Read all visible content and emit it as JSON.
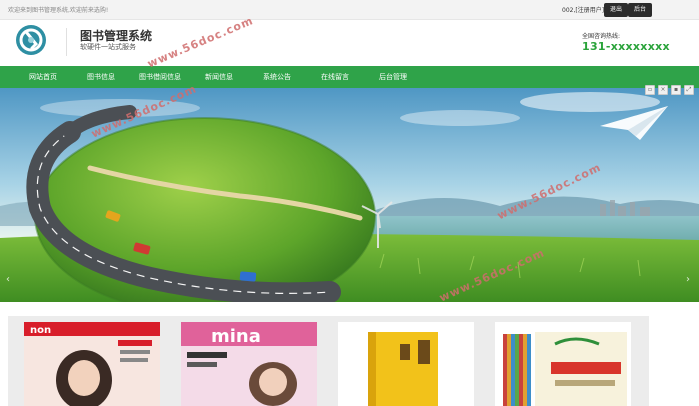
{
  "topbar": {
    "welcome": "欢迎来到图书管理系统,欢迎前来选购!",
    "user": "002,[注册用户]",
    "logout_label": "退出",
    "admin_label": "后台"
  },
  "header": {
    "title": "图书管理系统",
    "subtitle": "软硬件一站式服务",
    "hotline_label": "全国咨询热线:",
    "hotline": "131-xxxxxxxx"
  },
  "nav": {
    "items": [
      {
        "label": "网站首页"
      },
      {
        "label": "图书信息"
      },
      {
        "label": "图书借阅信息"
      },
      {
        "label": "新闻信息"
      },
      {
        "label": "系统公告"
      },
      {
        "label": "在线留言"
      },
      {
        "label": "后台管理"
      }
    ]
  },
  "toolbar_icons": [
    "save-icon",
    "resize-icon",
    "copy-icon",
    "expand-icon"
  ],
  "banner": {
    "prev_arrow": "‹",
    "next_arrow": "›",
    "slide_count": 3,
    "active_slide": 0
  },
  "watermarks": [
    "www.56doc.com",
    "www.56doc.com",
    "www.56doc.com",
    "www.56doc.com"
  ],
  "shelf": {
    "books": [
      {
        "name": "book-cover-magazine-red"
      },
      {
        "name": "book-cover-magazine-pink"
      },
      {
        "name": "book-cover-yellow"
      },
      {
        "name": "book-cover-children-set"
      }
    ]
  },
  "colors": {
    "nav_green": "#2fa349",
    "hotline_green": "#2aa33a",
    "logo_teal": "#2e8fa3"
  }
}
